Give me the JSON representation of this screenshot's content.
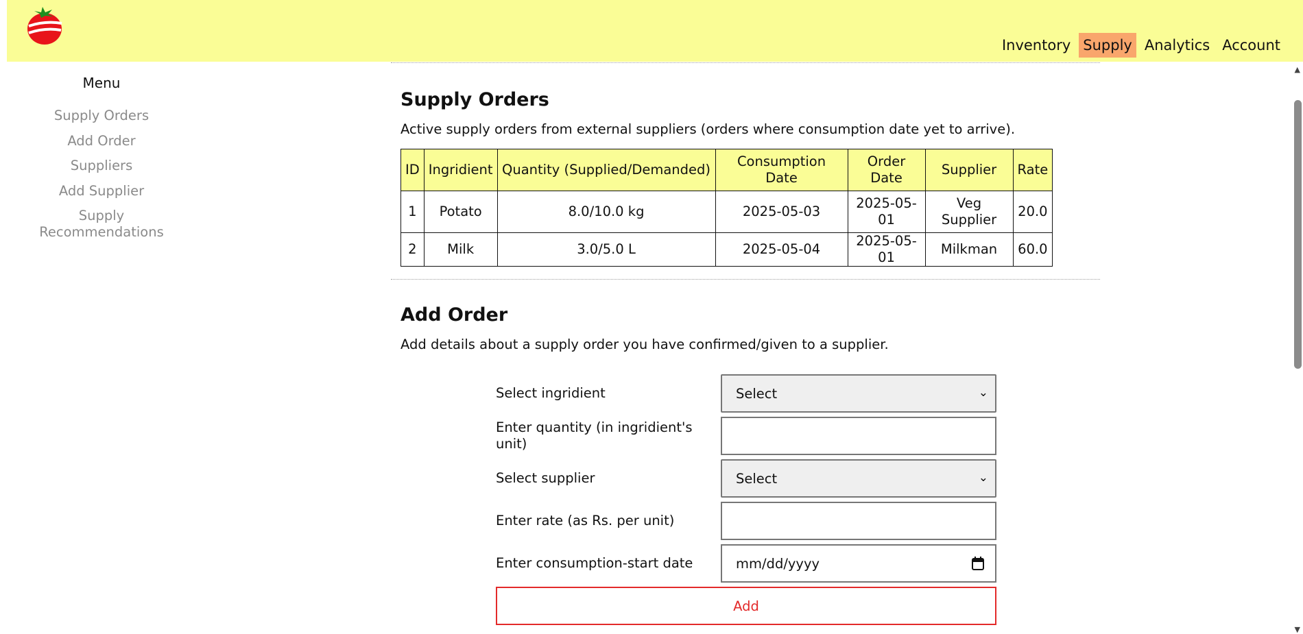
{
  "header": {
    "nav": [
      {
        "label": "Inventory",
        "active": false
      },
      {
        "label": "Supply",
        "active": true
      },
      {
        "label": "Analytics",
        "active": false
      },
      {
        "label": "Account",
        "active": false
      }
    ],
    "colors": {
      "header_bg": "#fafd96",
      "active_nav": "#f9a66c",
      "accent_red": "#e32a2a"
    }
  },
  "sidebar": {
    "title": "Menu",
    "items": [
      "Supply Orders",
      "Add Order",
      "Suppliers",
      "Add Supplier",
      "Supply Recommendations"
    ]
  },
  "supply_orders": {
    "title": "Supply Orders",
    "description": "Active supply orders from external suppliers (orders where consumption date yet to arrive).",
    "columns": [
      "ID",
      "Ingridient",
      "Quantity (Supplied/Demanded)",
      "Consumption Date",
      "Order Date",
      "Supplier",
      "Rate"
    ],
    "rows": [
      [
        "1",
        "Potato",
        "8.0/10.0 kg",
        "2025-05-03",
        "2025-05-01",
        "Veg Supplier",
        "20.0"
      ],
      [
        "2",
        "Milk",
        "3.0/5.0 L",
        "2025-05-04",
        "2025-05-01",
        "Milkman",
        "60.0"
      ]
    ]
  },
  "add_order": {
    "title": "Add Order",
    "description": "Add details about a supply order you have confirmed/given to a supplier.",
    "fields": {
      "ingredient_label": "Select ingridient",
      "ingredient_value": "Select",
      "quantity_label": "Enter quantity (in ingridient's unit)",
      "quantity_value": "",
      "supplier_label": "Select supplier",
      "supplier_value": "Select",
      "rate_label": "Enter rate (as Rs. per unit)",
      "rate_value": "",
      "date_label": "Enter consumption-start date",
      "date_placeholder": "mm/dd/yyyy"
    },
    "submit_label": "Add"
  }
}
